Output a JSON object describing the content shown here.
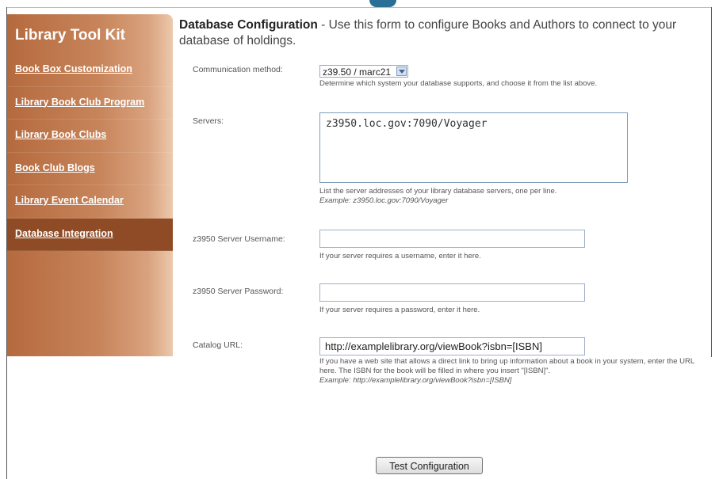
{
  "sidebar": {
    "title": "Library Tool Kit",
    "items": [
      {
        "label": "Book Box Customization"
      },
      {
        "label": "Library Book Club Program"
      },
      {
        "label": "Library Book Clubs"
      },
      {
        "label": "Book Club Blogs"
      },
      {
        "label": "Library Event Calendar"
      },
      {
        "label": "Database Integration",
        "active": true
      }
    ]
  },
  "header": {
    "title": "Database Configuration",
    "description": " - Use this form to configure Books and Authors to connect to your database of holdings."
  },
  "form": {
    "communication": {
      "label": "Communication method:",
      "value": "z39.50 / marc21",
      "hint": "Determine which system your database supports, and choose it from the list above."
    },
    "servers": {
      "label": "Servers:",
      "value": "z3950.loc.gov:7090/Voyager",
      "hint": "List the server addresses of your library database servers, one per line.",
      "example": "Example: z3950.loc.gov:7090/Voyager"
    },
    "username": {
      "label": "z3950 Server Username:",
      "value": "",
      "hint": "If your server requires a username, enter it here."
    },
    "password": {
      "label": "z3950 Server Password:",
      "value": "",
      "hint": "If your server requires a password, enter it here."
    },
    "catalog": {
      "label": "Catalog URL:",
      "value": "http://examplelibrary.org/viewBook?isbn=[ISBN]",
      "hint": "If you have a web site that allows a direct link to bring up information about a book in your system, enter the URL here. The ISBN for the book will be filled in where you insert \"[ISBN]\".",
      "example": "Example: http://examplelibrary.org/viewBook?isbn=[ISBN]"
    }
  },
  "actions": {
    "test_label": "Test Configuration"
  },
  "colors": {
    "sidebar": "#c7845a",
    "active_item": "#8f4b25",
    "logo": "#2a6f96"
  }
}
